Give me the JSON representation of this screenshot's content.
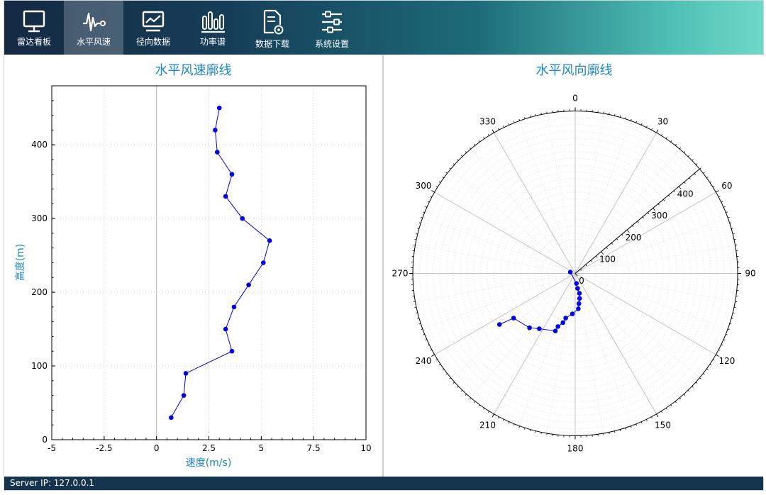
{
  "toolbar": {
    "tabs": [
      {
        "label": "雷达看板",
        "icon": "monitor-icon"
      },
      {
        "label": "水平风速",
        "icon": "waveform-icon"
      },
      {
        "label": "径向数据",
        "icon": "line-chart-icon"
      },
      {
        "label": "功率谱",
        "icon": "bar-spectrum-icon"
      },
      {
        "label": "数据下载",
        "icon": "file-download-icon"
      },
      {
        "label": "系统设置",
        "icon": "sliders-icon"
      }
    ],
    "active_tab": "水平风速"
  },
  "status": {
    "server_ip": "Server IP: 127.0.0.1"
  },
  "colors": {
    "accent": "#1c86c9",
    "series": "#0000e6",
    "toolbar_dark": "#152943",
    "toolbar_light": "#6fd8c8"
  },
  "chart_data": [
    {
      "type": "line",
      "title": "水平风速廓线",
      "xlabel": "速度(m/s)",
      "ylabel": "高度(m)",
      "xlim": [
        -5,
        10
      ],
      "ylim": [
        0,
        480
      ],
      "xticks": [
        "-5",
        "-2.5",
        "0",
        "2.5",
        "5",
        "7.5",
        "10"
      ],
      "yticks": [
        "0",
        "100",
        "200",
        "300",
        "400"
      ],
      "grid": true,
      "points": [
        {
          "speed": 0.7,
          "height": 30
        },
        {
          "speed": 1.3,
          "height": 60
        },
        {
          "speed": 1.4,
          "height": 90
        },
        {
          "speed": 3.6,
          "height": 120
        },
        {
          "speed": 3.3,
          "height": 150
        },
        {
          "speed": 3.7,
          "height": 180
        },
        {
          "speed": 4.4,
          "height": 210
        },
        {
          "speed": 5.1,
          "height": 240
        },
        {
          "speed": 5.4,
          "height": 270
        },
        {
          "speed": 4.1,
          "height": 300
        },
        {
          "speed": 3.3,
          "height": 330
        },
        {
          "speed": 3.6,
          "height": 360
        },
        {
          "speed": 2.9,
          "height": 390
        },
        {
          "speed": 2.8,
          "height": 420
        },
        {
          "speed": 3.0,
          "height": 450
        }
      ]
    },
    {
      "type": "scatter",
      "subtype": "polar",
      "title": "水平风向廓线",
      "angle_ticks": [
        "0",
        "30",
        "60",
        "90",
        "120",
        "150",
        "180",
        "210",
        "240",
        "270",
        "300",
        "330"
      ],
      "radial_ticks": [
        "0",
        "100",
        "200",
        "300",
        "400"
      ],
      "radial_axis_angle": 50,
      "rlim": [
        0,
        480
      ],
      "grid": true,
      "points": [
        {
          "direction": 285,
          "height": 15
        },
        {
          "direction": 173,
          "height": 30
        },
        {
          "direction": 171,
          "height": 45
        },
        {
          "direction": 168,
          "height": 60
        },
        {
          "direction": 170,
          "height": 75
        },
        {
          "direction": 173,
          "height": 90
        },
        {
          "direction": 175,
          "height": 105
        },
        {
          "direction": 184,
          "height": 120
        },
        {
          "direction": 192,
          "height": 135
        },
        {
          "direction": 194,
          "height": 150
        },
        {
          "direction": 198,
          "height": 165
        },
        {
          "direction": 199,
          "height": 180
        },
        {
          "direction": 213,
          "height": 195
        },
        {
          "direction": 220,
          "height": 210
        },
        {
          "direction": 234,
          "height": 225
        },
        {
          "direction": 236,
          "height": 270
        }
      ]
    }
  ]
}
